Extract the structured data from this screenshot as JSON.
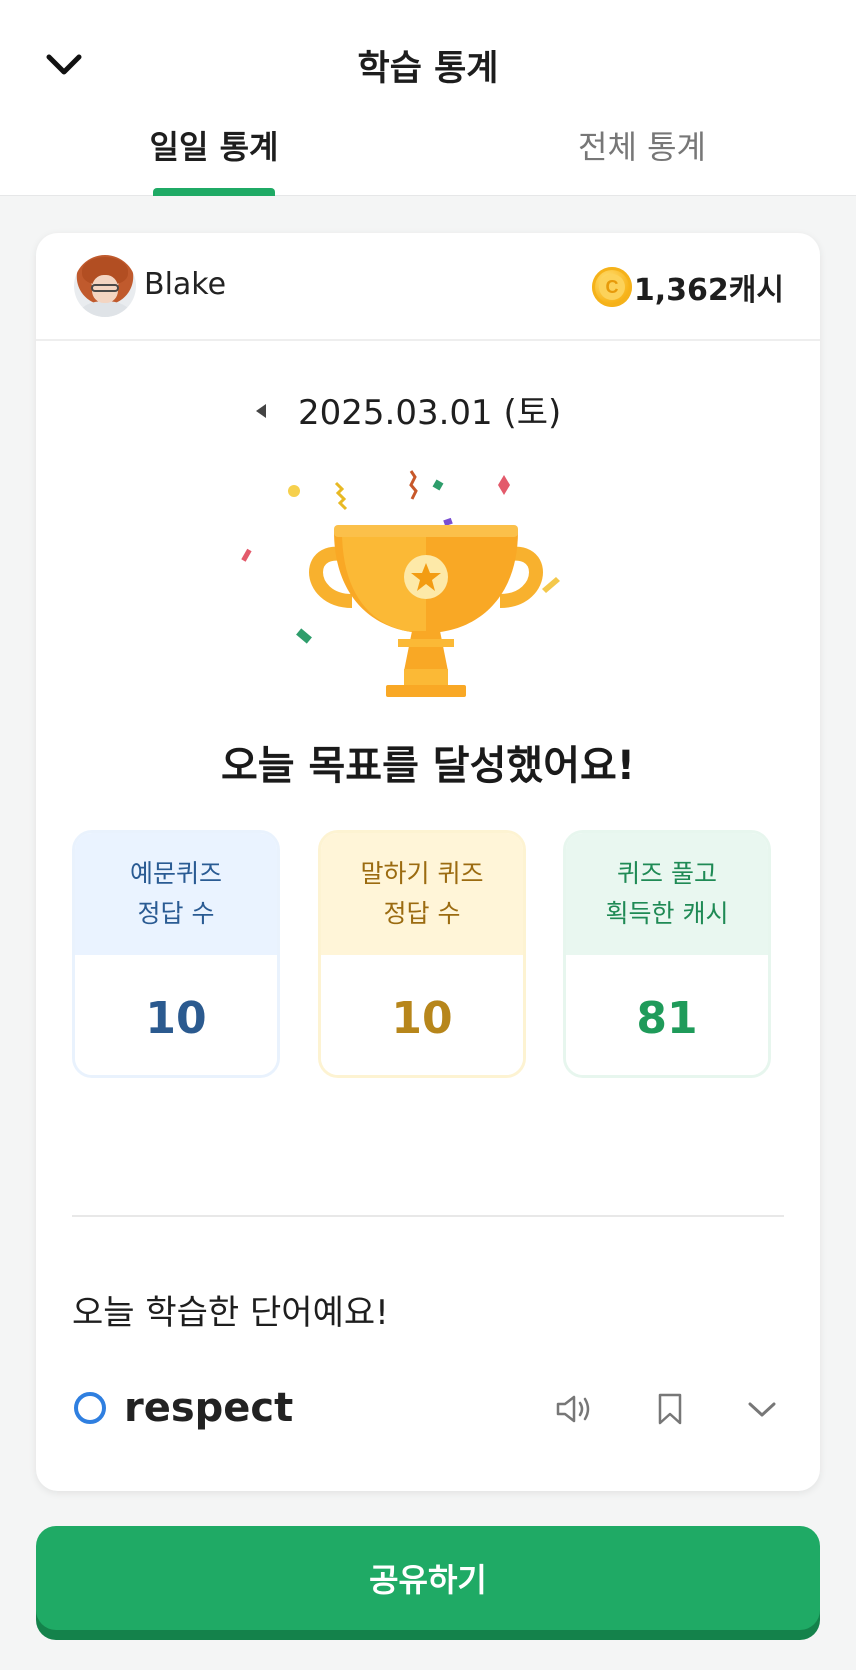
{
  "header": {
    "title": "학습 통계",
    "back_icon": "chevron-down-icon"
  },
  "tabs": [
    {
      "label": "일일 통계",
      "active": true
    },
    {
      "label": "전체 통계",
      "active": false
    }
  ],
  "user": {
    "name": "Blake",
    "cash": "1,362캐시"
  },
  "date": {
    "label": "2025.03.01 (토)"
  },
  "goal": {
    "message": "오늘 목표를 달성했어요!"
  },
  "stats": [
    {
      "label": "예문퀴즈\n정답 수",
      "value": "10",
      "color": "#2b5a8f"
    },
    {
      "label": "말하기 퀴즈\n정답 수",
      "value": "10",
      "color": "#b7861b"
    },
    {
      "label": "퀴즈 풀고\n획득한 캐시",
      "value": "81",
      "color": "#1f9b5a"
    }
  ],
  "words": {
    "title": "오늘 학습한 단어예요!",
    "items": [
      {
        "word": "respect"
      }
    ]
  },
  "share_button": {
    "label": "공유하기"
  },
  "colors": {
    "accent": "#1faa65",
    "status_circle": "#2f7fe0"
  }
}
